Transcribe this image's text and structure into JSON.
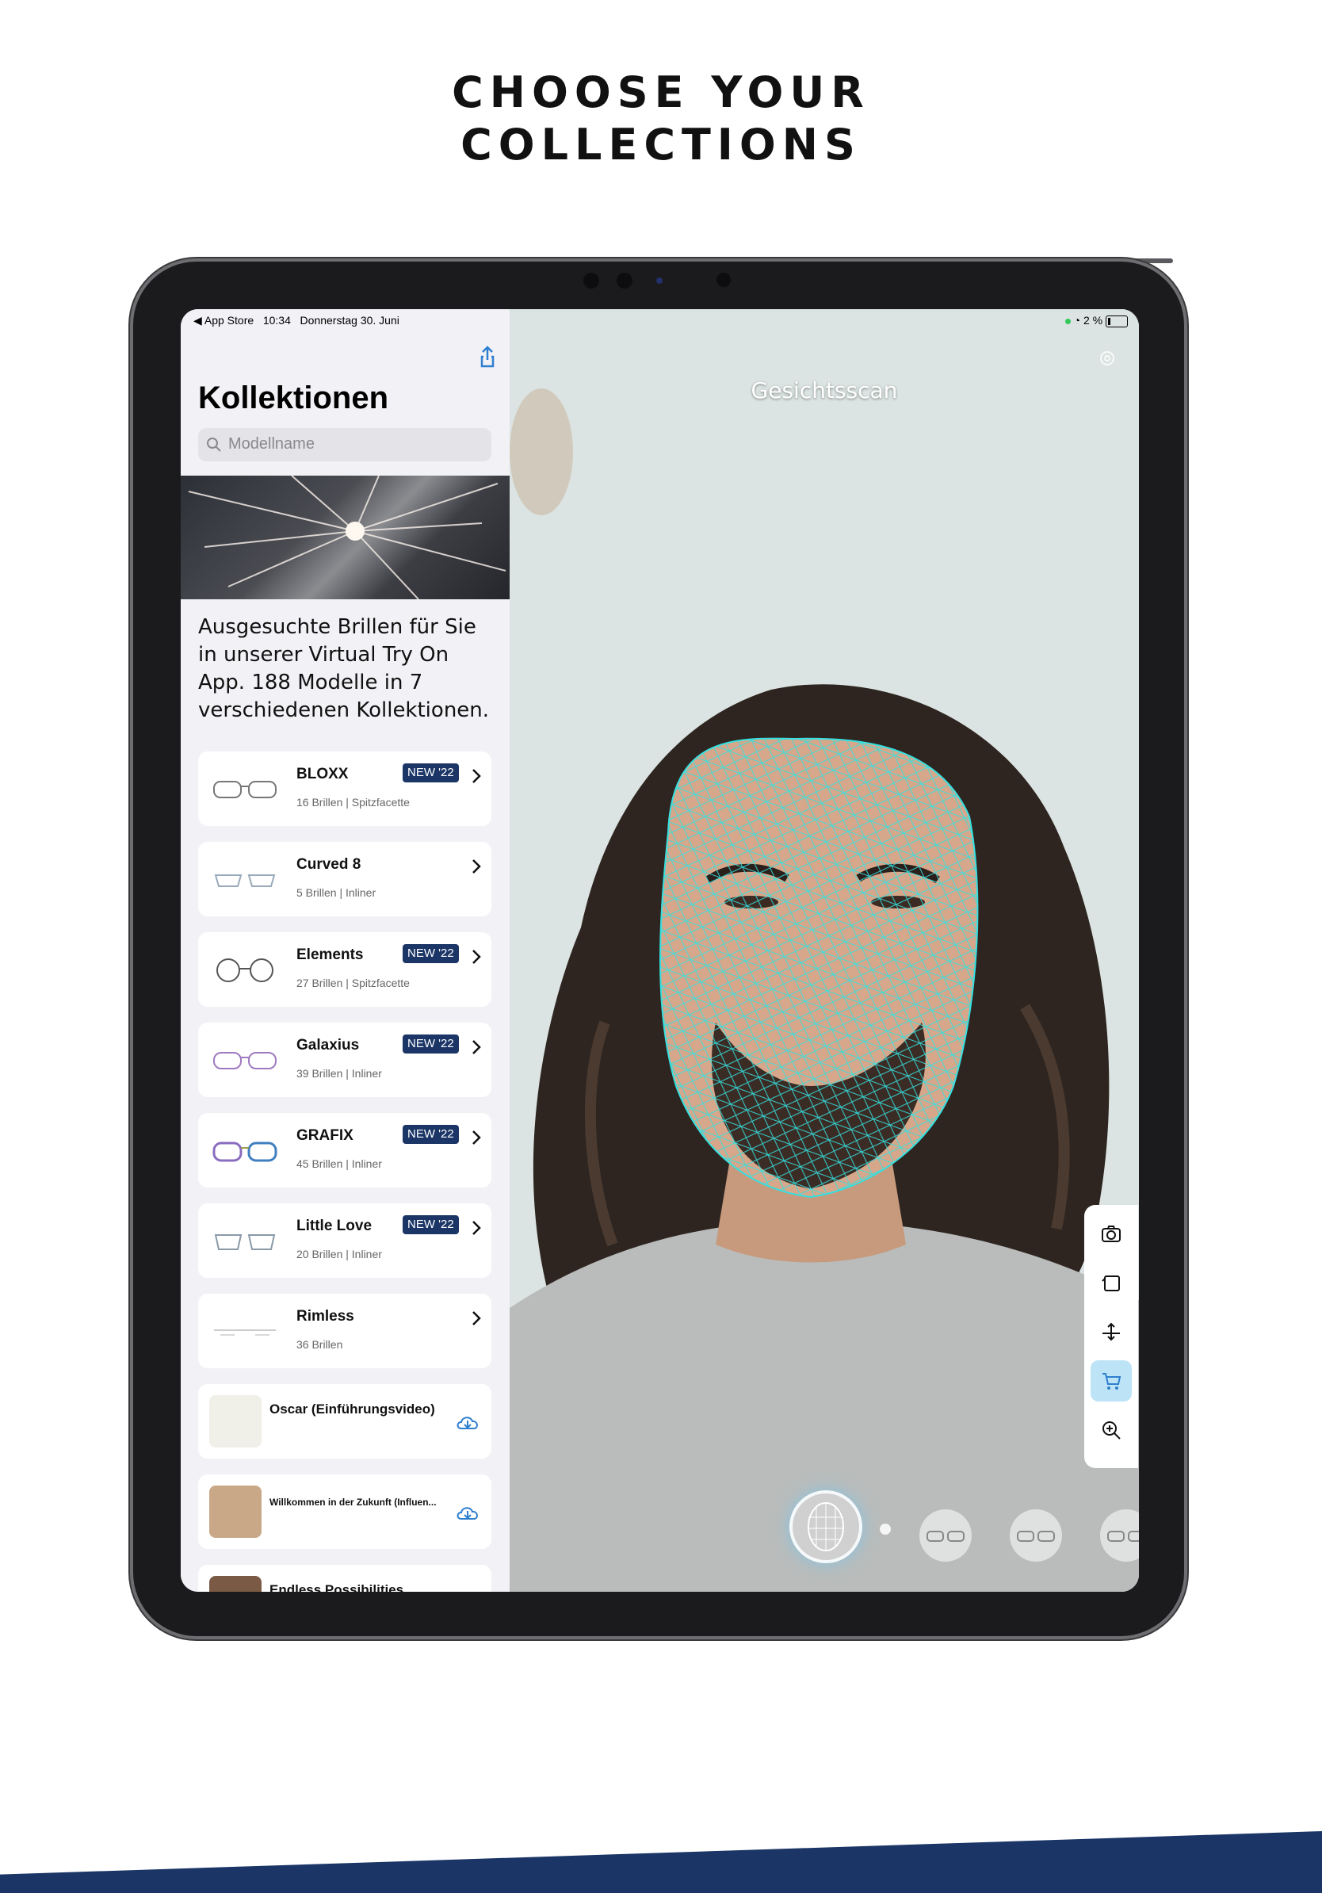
{
  "headline": {
    "line1": "CHOOSE YOUR",
    "line2": "COLLECTIONS"
  },
  "status_bar": {
    "back_app": "◀ App Store",
    "time": "10:34",
    "date": "Donnerstag 30. Juni",
    "battery": "2 %"
  },
  "sidebar": {
    "title": "Kollektionen",
    "search_placeholder": "Modellname",
    "intro": "Ausgesuchte Brillen für Sie in unserer Virtual Try On App. 188 Modelle in 7 verschiedenen Kollektionen.",
    "collections": [
      {
        "name": "BLOXX",
        "meta": "16 Brillen | Spitzfacette",
        "badge": "NEW '22"
      },
      {
        "name": "Curved 8",
        "meta": "5 Brillen | Inliner",
        "badge": ""
      },
      {
        "name": "Elements",
        "meta": "27 Brillen | Spitzfacette",
        "badge": "NEW '22"
      },
      {
        "name": "Galaxius",
        "meta": "39 Brillen | Inliner",
        "badge": "NEW '22"
      },
      {
        "name": "GRAFIX",
        "meta": "45 Brillen | Inliner",
        "badge": "NEW '22"
      },
      {
        "name": "Little Love",
        "meta": "20 Brillen | Inliner",
        "badge": "NEW '22"
      },
      {
        "name": "Rimless",
        "meta": "36 Brillen",
        "badge": ""
      }
    ],
    "videos": [
      {
        "name": "Oscar (Einführungsvideo)"
      },
      {
        "name": "Willkommen in der Zukunft (Influen..."
      },
      {
        "name": "Endless Possibilities"
      }
    ]
  },
  "camera": {
    "mode_label": "Gesichtsscan",
    "toolbar_icons": [
      "camera-icon",
      "rotate-icon",
      "measure-icon",
      "cart-icon",
      "zoom-in-icon"
    ]
  },
  "colors": {
    "brand_navy": "#1a3566",
    "accent_blue": "#2f7fd0",
    "mesh": "#35e0e0"
  }
}
